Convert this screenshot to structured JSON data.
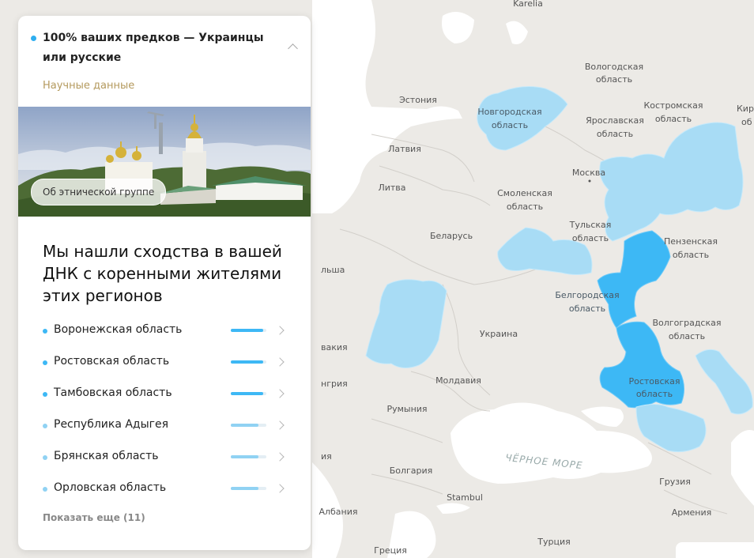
{
  "panel": {
    "title": "100% ваших предков — Украинцы или русские",
    "science_label": "Научные данные",
    "photo_chip": "Об этнической группе",
    "headline": "Мы нашли сходства в вашей ДНК с коренными жителями этих регионов",
    "regions": [
      {
        "name": "Воронежская область",
        "level": 0.9,
        "color": "#3db8f5"
      },
      {
        "name": "Ростовская область",
        "level": 0.9,
        "color": "#3db8f5"
      },
      {
        "name": "Тамбовская область",
        "level": 0.9,
        "color": "#3db8f5"
      },
      {
        "name": "Республика Адыгея",
        "level": 0.78,
        "color": "#90d2f3"
      },
      {
        "name": "Брянская область",
        "level": 0.78,
        "color": "#90d2f3"
      },
      {
        "name": "Орловская область",
        "level": 0.78,
        "color": "#90d2f3"
      }
    ],
    "show_more": "Показать еще (11)"
  },
  "map": {
    "labels": {
      "karelia": "Karelia",
      "vologda_1": "Вологодская",
      "vologda_2": "область",
      "estonia": "Эстония",
      "novgorod_1": "Новгородская",
      "novgorod_2": "область",
      "kostroma_1": "Костромская",
      "kostroma_2": "область",
      "yaroslavl_1": "Ярославская",
      "yaroslavl_2": "область",
      "kirov_1": "Киро",
      "kirov_2": "об",
      "latvia": "Латвия",
      "moscow": "Москва",
      "lithuania": "Литва",
      "smolensk_1": "Смоленская",
      "smolensk_2": "область",
      "tula_1": "Тульская",
      "tula_2": "область",
      "belarus": "Беларусь",
      "penza_1": "Пензенская",
      "penza_2": "область",
      "belgorod_1": "Белгородская",
      "belgorod_2": "область",
      "volgograd_1": "Волгоградская",
      "volgograd_2": "область",
      "ukraine": "Украина",
      "rostov_1": "Ростовская",
      "rostov_2": "область",
      "moldova": "Молдавия",
      "romania": "Румыния",
      "black_sea": "ЧЁРНОЕ МОРЕ",
      "bulgaria": "Болгария",
      "georgia": "Грузия",
      "istanbul": "Stambul",
      "armenia": "Армения",
      "albania": "Албания",
      "greece": "Греция",
      "turkey": "Турция",
      "edge_poland": "льша",
      "edge_slovakia": "вакия",
      "edge_hungary": "нгрия",
      "edge_serbia": "ия"
    },
    "colors": {
      "land": "#eceae6",
      "water": "#ffffff",
      "border": "#d2cfca",
      "light_region": "#a8dcf5",
      "mid_region": "#8ccff2",
      "strong_region": "#3db8f5"
    }
  }
}
